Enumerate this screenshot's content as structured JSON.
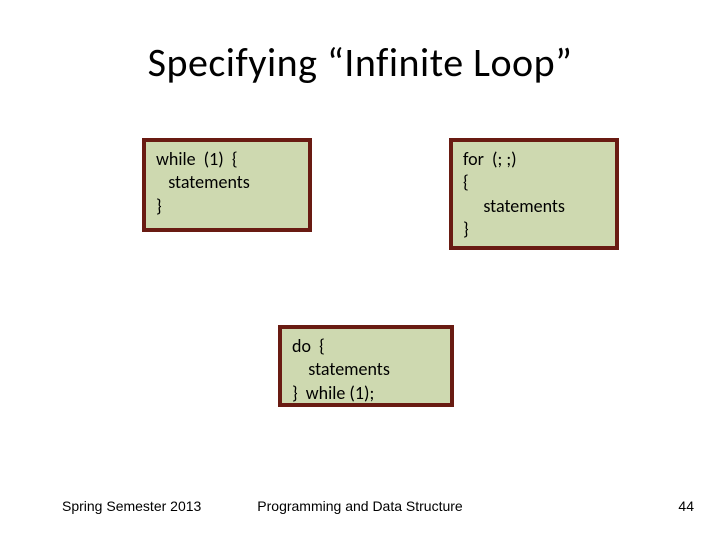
{
  "title": "Specifying “Infinite Loop”",
  "whileBox": {
    "l1": "while  (1)  {",
    "l2": "   statements",
    "l3": "}"
  },
  "forBox": {
    "l1": "for  (; ;)",
    "l2": "{",
    "l3": "     statements",
    "l4": "}"
  },
  "doBox": {
    "l1": "do  {",
    "l2": "    statements",
    "l3": "}  while (1);"
  },
  "footer": {
    "left": "Spring Semester 2013",
    "center": "Programming and Data Structure",
    "right": "44"
  }
}
